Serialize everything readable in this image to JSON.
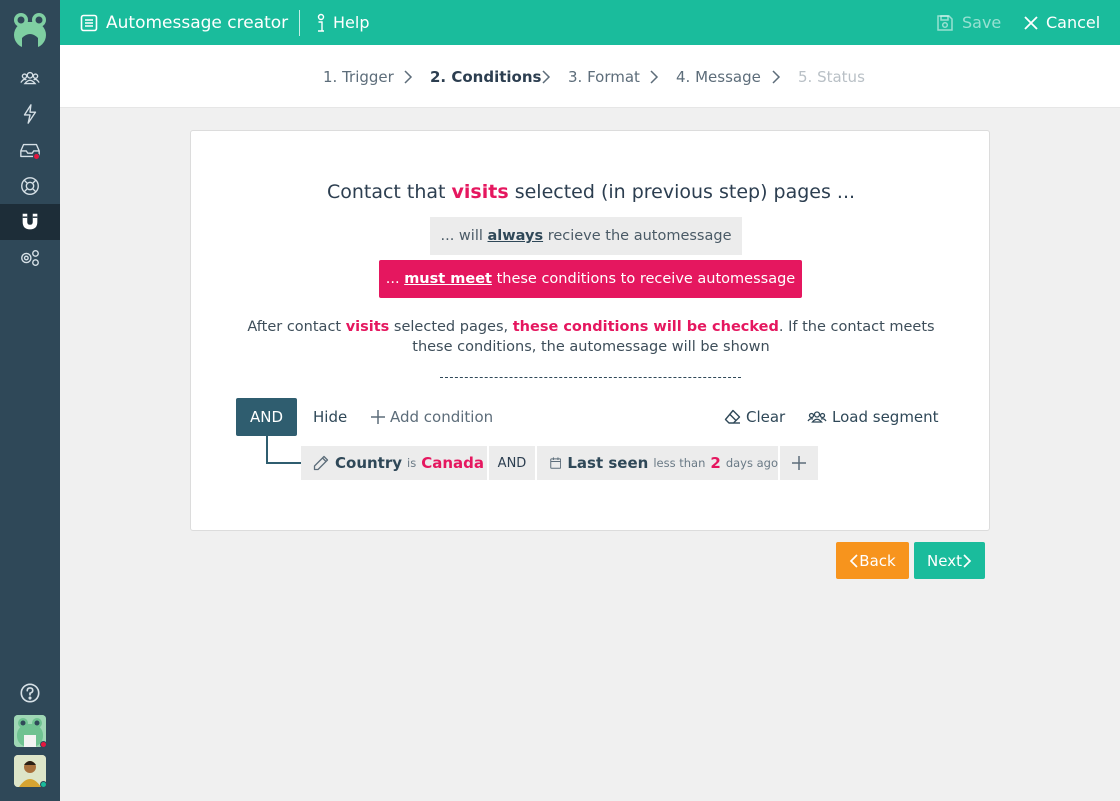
{
  "header": {
    "title": "Automessage creator",
    "help_label": "Help",
    "save_label": "Save",
    "cancel_label": "Cancel"
  },
  "colors": {
    "header": "#1abc9c",
    "sidebar": "#2f4858",
    "accent_pink": "#e5175f",
    "back_button": "#f7941d",
    "next_button": "#1abc9c",
    "and_button": "#2f5d6f"
  },
  "sidebar": {
    "items": [
      {
        "icon": "contacts-icon"
      },
      {
        "icon": "lightning-icon"
      },
      {
        "icon": "inbox-icon",
        "badge": true
      },
      {
        "icon": "lifebuoy-icon"
      },
      {
        "icon": "magnet-icon",
        "active": true
      },
      {
        "icon": "gears-icon"
      }
    ],
    "bottom": [
      {
        "icon": "help-icon"
      },
      {
        "icon": "bot-avatar"
      },
      {
        "icon": "user-avatar"
      }
    ]
  },
  "stepper": {
    "steps": [
      {
        "label": "1. Trigger",
        "state": "done"
      },
      {
        "label": "2. Conditions",
        "state": "active"
      },
      {
        "label": "3. Format",
        "state": "todo"
      },
      {
        "label": "4. Message",
        "state": "todo"
      },
      {
        "label": "5. Status",
        "state": "disabled"
      }
    ]
  },
  "main": {
    "question": {
      "pre": "Contact that ",
      "highlight": "visits",
      "post": " selected (in previous step) pages ..."
    },
    "option_always": {
      "pre": "... will ",
      "emph": "always",
      "post": " recieve the automessage"
    },
    "option_must": {
      "pre": "... ",
      "emph": "must meet",
      "post": " these conditions to receive automessage"
    },
    "description": {
      "p1": "After contact ",
      "h1": "visits",
      "p2": " selected pages, ",
      "h2": "these conditions will be checked",
      "p3": ". If the contact meets these conditions, the automessage will be shown"
    },
    "toolbar": {
      "and_label": "AND",
      "hide_label": "Hide",
      "add_label": "Add condition",
      "clear_label": "Clear",
      "load_label": "Load segment"
    },
    "conditions": [
      {
        "field": "Country",
        "operator": "is",
        "value": "Canada"
      },
      {
        "field": "Last seen",
        "operator": "less than",
        "value": "2",
        "unit": "days ago"
      }
    ],
    "connector": "AND"
  },
  "nav": {
    "back_label": "Back",
    "next_label": "Next"
  }
}
